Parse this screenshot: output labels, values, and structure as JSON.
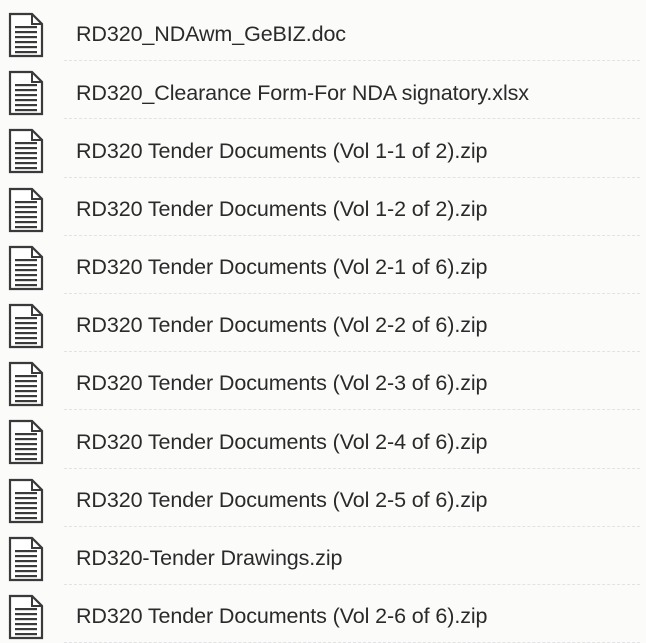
{
  "files": [
    {
      "name": "RD320_NDAwm_GeBIZ.doc",
      "icon": "document-icon"
    },
    {
      "name": "RD320_Clearance Form-For NDA signatory.xlsx",
      "icon": "document-icon"
    },
    {
      "name": "RD320 Tender Documents (Vol 1-1 of 2).zip",
      "icon": "document-icon"
    },
    {
      "name": "RD320 Tender Documents (Vol 1-2 of 2).zip",
      "icon": "document-icon"
    },
    {
      "name": "RD320 Tender Documents (Vol 2-1 of 6).zip",
      "icon": "document-icon"
    },
    {
      "name": "RD320 Tender Documents (Vol 2-2 of 6).zip",
      "icon": "document-icon"
    },
    {
      "name": "RD320 Tender Documents (Vol 2-3 of 6).zip",
      "icon": "document-icon"
    },
    {
      "name": "RD320 Tender Documents (Vol 2-4 of 6).zip",
      "icon": "document-icon"
    },
    {
      "name": "RD320 Tender Documents (Vol 2-5 of 6).zip",
      "icon": "document-icon"
    },
    {
      "name": "RD320-Tender Drawings.zip",
      "icon": "document-icon"
    },
    {
      "name": "RD320 Tender Documents (Vol 2-6 of 6).zip",
      "icon": "document-icon"
    }
  ],
  "colors": {
    "background": "#fbfbfa",
    "text": "#2a2a2a",
    "icon_stroke": "#3a3a3a"
  }
}
